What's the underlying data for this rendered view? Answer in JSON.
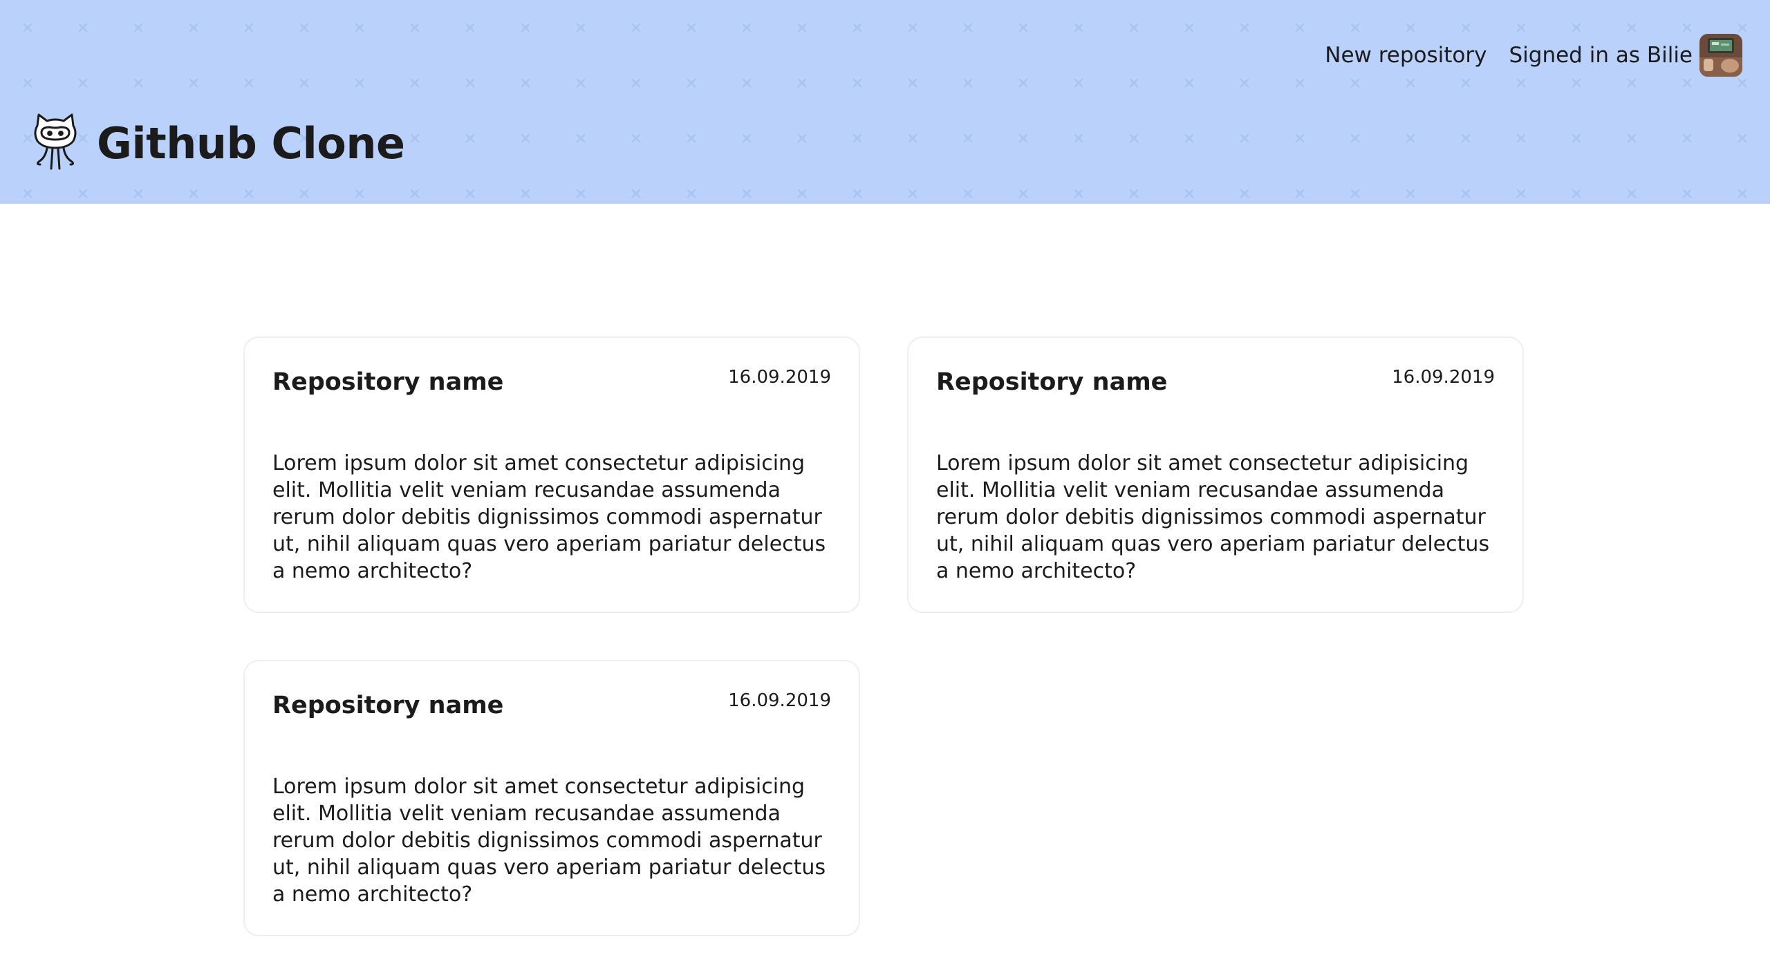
{
  "header": {
    "background_color": "#b9d1fb",
    "pattern_mark": "×",
    "brand": {
      "title": "Github Clone",
      "logo_icon": "octocat-icon"
    },
    "nav": {
      "new_repository": "New repository",
      "signed_in_label": "Signed in as Bilie",
      "avatar_icon": "user-avatar"
    }
  },
  "repositories": [
    {
      "name": "Repository name",
      "date": "16.09.2019",
      "description": "Lorem ipsum dolor sit amet consectetur adipisicing elit. Mollitia velit veniam recusandae assumenda rerum dolor debitis dignissimos commodi aspernatur ut, nihil aliquam quas vero aperiam pariatur delectus a nemo architecto?"
    },
    {
      "name": "Repository name",
      "date": "16.09.2019",
      "description": "Lorem ipsum dolor sit amet consectetur adipisicing elit. Mollitia velit veniam recusandae assumenda rerum dolor debitis dignissimos commodi aspernatur ut, nihil aliquam quas vero aperiam pariatur delectus a nemo architecto?"
    },
    {
      "name": "Repository name",
      "date": "16.09.2019",
      "description": "Lorem ipsum dolor sit amet consectetur adipisicing elit. Mollitia velit veniam recusandae assumenda rerum dolor debitis dignissimos commodi aspernatur ut, nihil aliquam quas vero aperiam pariatur delectus a nemo architecto?"
    }
  ]
}
